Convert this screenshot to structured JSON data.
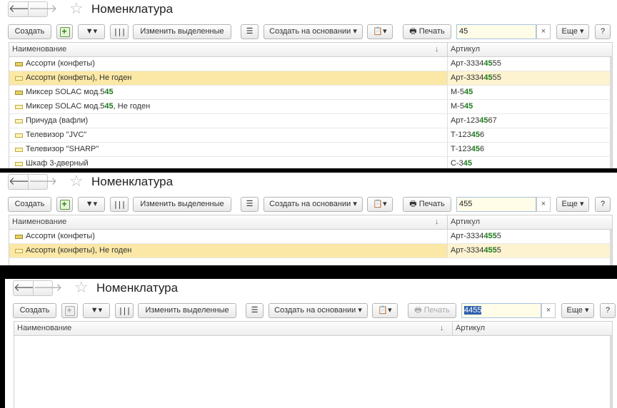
{
  "panels": [
    {
      "title": "Номенклатура",
      "toolbar": {
        "create_label": "Создать",
        "change_selected_label": "Изменить выделенные",
        "create_based_label": "Создать на основании ▾",
        "print_label": "Печать",
        "more_label": "Еще ▾",
        "help_label": "?",
        "clear_label": "×"
      },
      "search_value": "45",
      "columns": {
        "name": "Наименование",
        "sort_marker": "↓",
        "article": "Артикул"
      },
      "rows": [
        {
          "name_parts": [
            "Ассорти (конфеты)"
          ],
          "article_parts": [
            "Арт-3334",
            "45",
            "55"
          ],
          "selected": false,
          "mark": "dark"
        },
        {
          "name_parts": [
            "Ассорти (конфеты), Не годен"
          ],
          "article_parts": [
            "Арт-3334",
            "45",
            "55"
          ],
          "selected": true,
          "mark": "light"
        },
        {
          "name_parts": [
            "Миксер SOLAC мод.5",
            "45",
            ""
          ],
          "article_parts": [
            "М-5",
            "45",
            ""
          ],
          "selected": false,
          "mark": "dark"
        },
        {
          "name_parts": [
            "Миксер SOLAC мод.5",
            "45",
            ", Не годен"
          ],
          "article_parts": [
            "М-5",
            "45",
            ""
          ],
          "selected": false,
          "mark": "light"
        },
        {
          "name_parts": [
            "Причуда (вафли)"
          ],
          "article_parts": [
            "Арт-123",
            "45",
            "67"
          ],
          "selected": false,
          "mark": "light"
        },
        {
          "name_parts": [
            "Телевизор \"JVC\""
          ],
          "article_parts": [
            "Т-123",
            "45",
            "6"
          ],
          "selected": false,
          "mark": "light"
        },
        {
          "name_parts": [
            "Телевизор \"SHARP\""
          ],
          "article_parts": [
            "Т-123",
            "45",
            "6"
          ],
          "selected": false,
          "mark": "light"
        },
        {
          "name_parts": [
            "Шкаф 3-дверный"
          ],
          "article_parts": [
            "С-3",
            "45",
            ""
          ],
          "selected": false,
          "mark": "light"
        }
      ]
    },
    {
      "title": "Номенклатура",
      "toolbar": {
        "create_label": "Создать",
        "change_selected_label": "Изменить выделенные",
        "create_based_label": "Создать на основании ▾",
        "print_label": "Печать",
        "more_label": "Еще ▾",
        "help_label": "?",
        "clear_label": "×"
      },
      "search_value": "455",
      "columns": {
        "name": "Наименование",
        "sort_marker": "↓",
        "article": "Артикул"
      },
      "rows": [
        {
          "name_parts": [
            "Ассорти (конфеты)"
          ],
          "article_parts": [
            "Арт-3334",
            "455",
            "5"
          ],
          "selected": false,
          "mark": "dark"
        },
        {
          "name_parts": [
            "Ассорти (конфеты), Не годен"
          ],
          "article_parts": [
            "Арт-3334",
            "455",
            "5"
          ],
          "selected": true,
          "mark": "light"
        }
      ]
    },
    {
      "title": "Номенклатура",
      "toolbar": {
        "create_label": "Создать",
        "change_selected_label": "Изменить выделенные",
        "create_based_label": "Создать на основании ▾",
        "print_label": "Печать",
        "more_label": "Еще ▾",
        "help_label": "?",
        "clear_label": "×"
      },
      "search_value": "4455",
      "columns": {
        "name": "Наименование",
        "sort_marker": "↓",
        "article": "Артикул"
      },
      "rows": []
    }
  ]
}
